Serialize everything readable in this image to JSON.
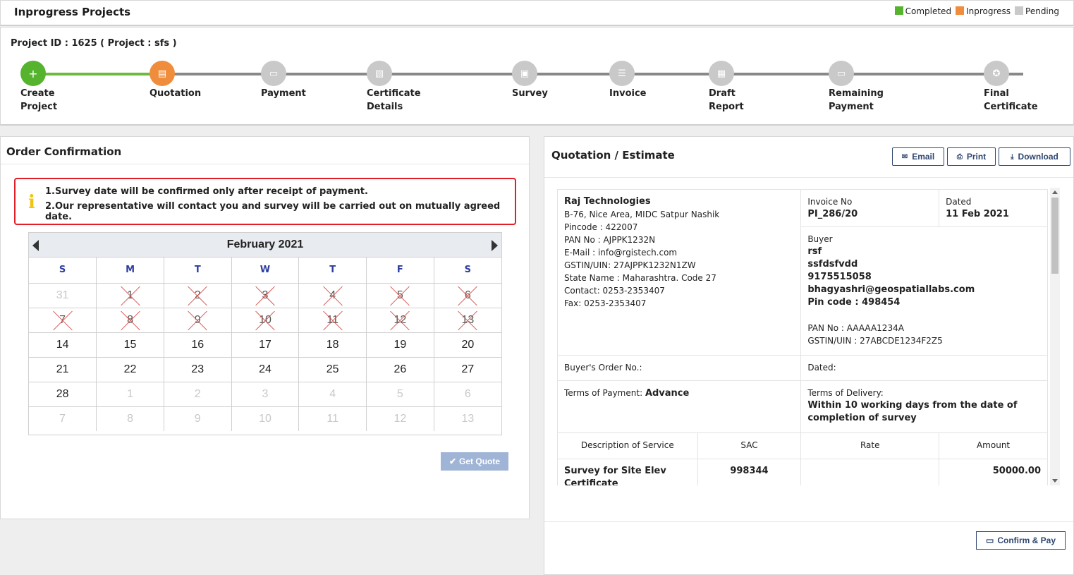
{
  "header": {
    "title": "Inprogress Projects"
  },
  "legend": [
    {
      "label": "Completed",
      "color": "#55b32e"
    },
    {
      "label": "Inprogress",
      "color": "#f08d3c"
    },
    {
      "label": "Pending",
      "color": "#c9c9c9"
    }
  ],
  "progress": {
    "project_id": "Project ID : 1625 ( Project : sfs )",
    "steps": [
      {
        "label": "Create\nProject",
        "status": "completed",
        "icon": "plus-icon"
      },
      {
        "label": "Quotation",
        "status": "inprogress",
        "icon": "document-icon"
      },
      {
        "label": "Payment",
        "status": "pending",
        "icon": "card-icon"
      },
      {
        "label": "Certificate\nDetails",
        "status": "pending",
        "icon": "certificate-icon"
      },
      {
        "label": "Survey",
        "status": "pending",
        "icon": "calendar-icon"
      },
      {
        "label": "Invoice",
        "status": "pending",
        "icon": "list-icon"
      },
      {
        "label": "Draft\nReport",
        "status": "pending",
        "icon": "report-icon"
      },
      {
        "label": "Remaining\nPayment",
        "status": "pending",
        "icon": "card-icon"
      },
      {
        "label": "Final\nCertificate",
        "status": "pending",
        "icon": "badge-icon"
      }
    ]
  },
  "order": {
    "title": "Order Confirmation",
    "notes": [
      "1.Survey date will be confirmed only after receipt of payment.",
      "2.Our representative will contact you and survey will be carried out on mutually agreed date."
    ],
    "calendar": {
      "month": "February 2021",
      "weekdays": [
        "S",
        "M",
        "T",
        "W",
        "T",
        "F",
        "S"
      ],
      "weeks": [
        [
          {
            "d": "31",
            "s": "other"
          },
          {
            "d": "1",
            "s": "disabled"
          },
          {
            "d": "2",
            "s": "disabled"
          },
          {
            "d": "3",
            "s": "disabled"
          },
          {
            "d": "4",
            "s": "disabled"
          },
          {
            "d": "5",
            "s": "disabled"
          },
          {
            "d": "6",
            "s": "disabled"
          }
        ],
        [
          {
            "d": "7",
            "s": "disabled"
          },
          {
            "d": "8",
            "s": "disabled"
          },
          {
            "d": "9",
            "s": "disabled"
          },
          {
            "d": "10",
            "s": "disabled"
          },
          {
            "d": "11",
            "s": "disabled"
          },
          {
            "d": "12",
            "s": "disabled"
          },
          {
            "d": "13",
            "s": "disabled"
          }
        ],
        [
          {
            "d": "14",
            "s": "active"
          },
          {
            "d": "15",
            "s": "active"
          },
          {
            "d": "16",
            "s": "active"
          },
          {
            "d": "17",
            "s": "active"
          },
          {
            "d": "18",
            "s": "active"
          },
          {
            "d": "19",
            "s": "active"
          },
          {
            "d": "20",
            "s": "active"
          }
        ],
        [
          {
            "d": "21",
            "s": "active"
          },
          {
            "d": "22",
            "s": "active"
          },
          {
            "d": "23",
            "s": "active"
          },
          {
            "d": "24",
            "s": "active"
          },
          {
            "d": "25",
            "s": "active"
          },
          {
            "d": "26",
            "s": "active"
          },
          {
            "d": "27",
            "s": "active"
          }
        ],
        [
          {
            "d": "28",
            "s": "active"
          },
          {
            "d": "1",
            "s": "other"
          },
          {
            "d": "2",
            "s": "other"
          },
          {
            "d": "3",
            "s": "other"
          },
          {
            "d": "4",
            "s": "other"
          },
          {
            "d": "5",
            "s": "other"
          },
          {
            "d": "6",
            "s": "other"
          }
        ],
        [
          {
            "d": "7",
            "s": "other"
          },
          {
            "d": "8",
            "s": "other"
          },
          {
            "d": "9",
            "s": "other"
          },
          {
            "d": "10",
            "s": "other"
          },
          {
            "d": "11",
            "s": "other"
          },
          {
            "d": "12",
            "s": "other"
          },
          {
            "d": "13",
            "s": "other"
          }
        ]
      ]
    },
    "get_quote_label": "Get Quote"
  },
  "quote": {
    "title": "Quotation / Estimate",
    "buttons": {
      "email": "Email",
      "print": "Print",
      "download": "Download"
    },
    "seller": {
      "name": "Raj Technologies",
      "lines": [
        "B-76, Nice Area, MIDC Satpur Nashik",
        "Pincode : 422007",
        "PAN No : AJPPK1232N",
        "E-Mail : info@rgistech.com",
        "GSTIN/UIN: 27AJPPK1232N1ZW",
        "State Name : Maharashtra. Code 27",
        "Contact: 0253-2353407",
        "Fax: 0253-2353407"
      ]
    },
    "invoice_no_label": "Invoice No",
    "invoice_no": "PI_286/20",
    "dated_label": "Dated",
    "dated": "11 Feb 2021",
    "buyer": {
      "label": "Buyer",
      "bold_lines": [
        "rsf",
        "ssfdsfvdd",
        "9175515058",
        "bhagyashri@geospatiallabs.com",
        "Pin code : 498454"
      ],
      "lines": [
        "PAN No : AAAAA1234A",
        "GSTIN/UIN : 27ABCDE1234F2Z5"
      ]
    },
    "buyers_order_label": "Buyer's Order No.:",
    "buyers_dated_label": "Dated:",
    "terms_payment_label": "Terms of Payment: ",
    "terms_payment": "Advance",
    "terms_delivery_label": "Terms of Delivery:",
    "terms_delivery": "Within 10 working days from the date of completion of survey",
    "columns": [
      "Description of Service",
      "SAC",
      "Rate",
      "Amount"
    ],
    "rows": [
      {
        "desc": "Survey for Site Elev Certificate",
        "sac": "998344",
        "rate": "",
        "amount": "50000.00"
      }
    ],
    "confirm_label": "Confirm & Pay"
  }
}
